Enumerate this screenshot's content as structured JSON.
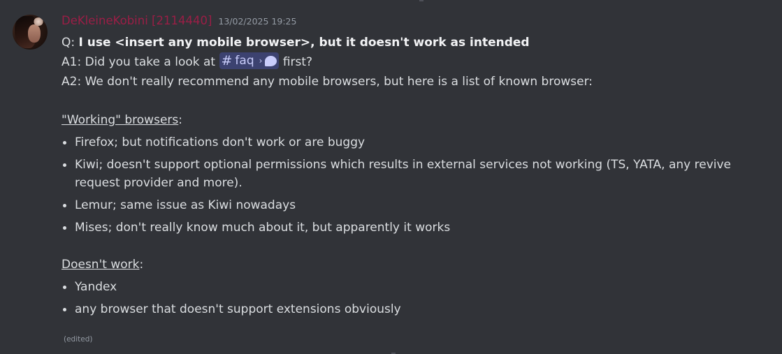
{
  "message": {
    "author": "DeKleineKobini [2114440]",
    "timestamp": "13/02/2025 19:25",
    "q_prefix": "Q: ",
    "q_text": "I use <insert any mobile browser>, but it doesn't work as intended",
    "a1_prefix": "A1: Did you take a look at ",
    "a1_suffix": " first?",
    "channel_mention": {
      "hash": "#",
      "name": "faq",
      "chevron": "›",
      "icon": "forum-bubble-icon"
    },
    "a2_text": "A2: We don't really recommend any mobile browsers, but here is a list of known browser:",
    "working_title": "\"Working\" browsers",
    "working_colon": ":",
    "working_items": [
      "Firefox; but notifications don't work or are buggy",
      "Kiwi; doesn't support optional permissions which results in external services not working (TS, YATA, any revive request provider and more).",
      "Lemur; same issue as Kiwi nowadays",
      "Mises; don't really know much about it, but apparently it works"
    ],
    "notworking_title": "Doesn't work",
    "notworking_colon": ":",
    "notworking_items": [
      "Yandex",
      "any browser that doesn't support extensions obviously"
    ],
    "edited_label": "(edited)"
  },
  "colors": {
    "background": "#313338",
    "username": "#9b1e46",
    "text": "#dbdee1",
    "muted": "#949ba4",
    "mention_bg": "#3c4270",
    "mention_fg": "#c9cdfb"
  }
}
